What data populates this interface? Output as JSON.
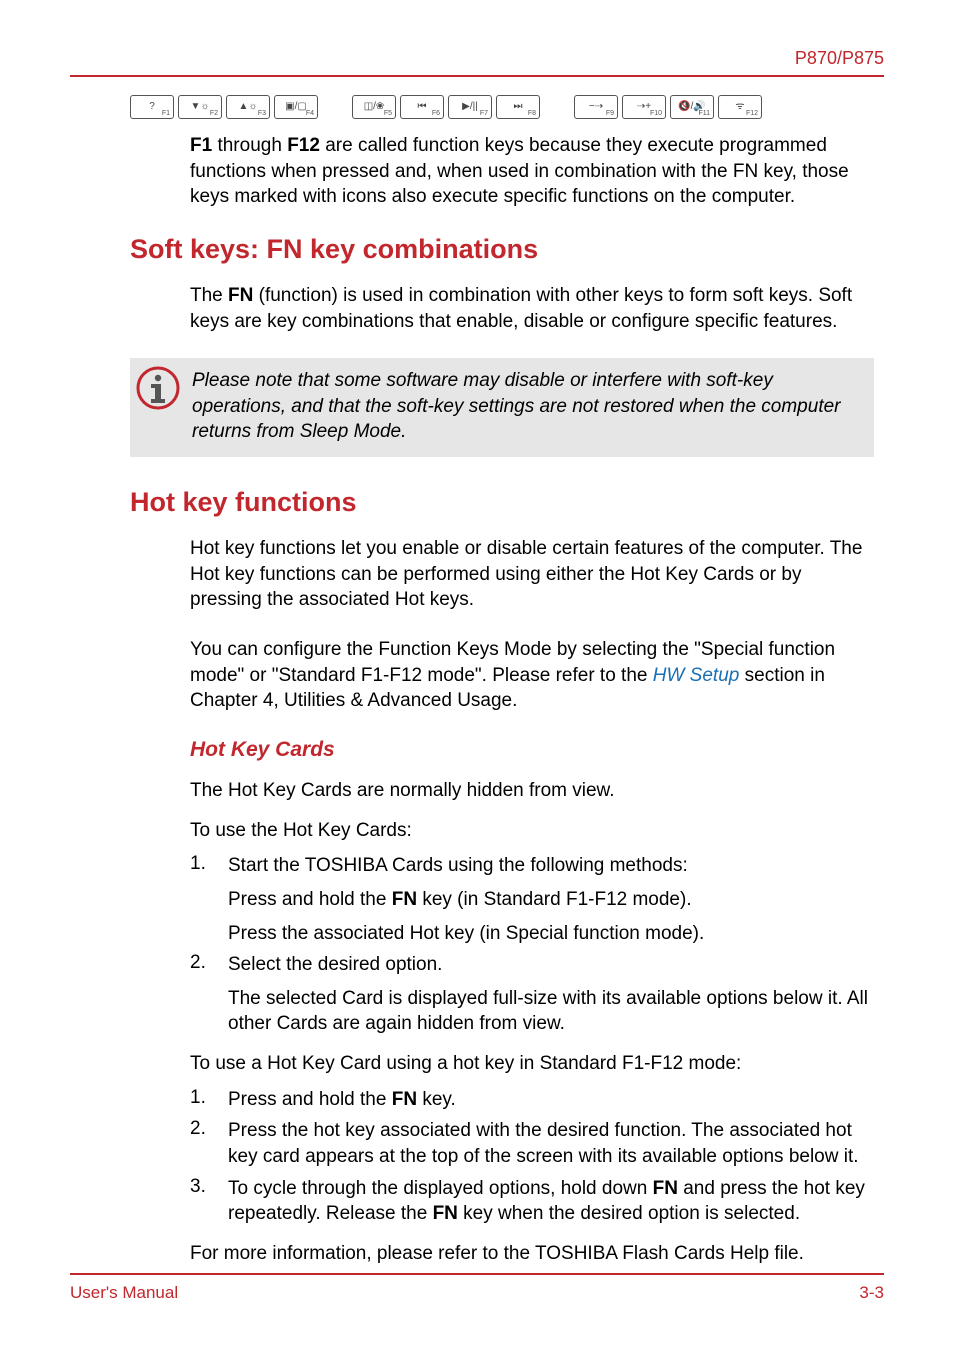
{
  "header": {
    "model": "P870/P875"
  },
  "fn_keys": [
    {
      "glyph": "?",
      "num": "F1"
    },
    {
      "glyph": "▼☼",
      "num": "F2"
    },
    {
      "glyph": "▲☼",
      "num": "F3"
    },
    {
      "glyph": "▣/▢",
      "num": "F4"
    },
    {
      "glyph": "◫/❀",
      "num": "F5"
    },
    {
      "glyph": "⏮",
      "num": "F6"
    },
    {
      "glyph": "▶/||",
      "num": "F7"
    },
    {
      "glyph": "⏭",
      "num": "F8"
    },
    {
      "glyph": "−⇢",
      "num": "F9"
    },
    {
      "glyph": "⇢+",
      "num": "F10"
    },
    {
      "glyph": "🔇/🔊",
      "num": "F11"
    },
    {
      "glyph": "ᯤ",
      "num": "F12"
    }
  ],
  "intro_para": {
    "strong1": "F1",
    "mid": " through ",
    "strong2": "F12",
    "rest": " are called function keys because they execute programmed functions when pressed and, when used in combination with the FN key, those keys marked with icons also execute specific functions on the computer."
  },
  "softkeys": {
    "heading": "Soft keys: FN key combinations",
    "para_a": "The ",
    "para_b": "FN",
    "para_c": " (function) is used in combination with other keys to form soft keys. Soft keys are key combinations that enable, disable or configure specific features."
  },
  "note": "Please note that some software may disable or interfere with soft-key operations, and that the soft-key settings are not restored when the computer returns from Sleep Mode.",
  "hotkey": {
    "heading": "Hot key functions",
    "p1": "Hot key functions let you enable or disable certain features of the computer. The Hot key functions can be performed using either the Hot Key Cards or by pressing the associated Hot keys.",
    "p2a": "You can configure the Function Keys Mode by selecting the \"Special function mode\" or \"Standard F1-F12 mode\". Please refer to the ",
    "p2_link": "HW Setup",
    "p2b": " section in Chapter 4, Utilities & Advanced Usage."
  },
  "cards": {
    "heading": "Hot Key Cards",
    "p1": "The Hot Key Cards are normally hidden from view.",
    "p2": "To use the Hot Key Cards:",
    "list1": [
      {
        "n": "1.",
        "text": "Start the TOSHIBA Cards using the following methods:",
        "subs": [
          {
            "a": "Press and hold the ",
            "b": "FN",
            "c": " key (in Standard F1-F12 mode)."
          },
          {
            "a": "Press the associated Hot key (in Special function mode).",
            "b": "",
            "c": ""
          }
        ]
      },
      {
        "n": "2.",
        "text": "Select the desired option.",
        "subs": [
          {
            "a": "The selected Card is displayed full-size with its available options below it. All other Cards are again hidden from view.",
            "b": "",
            "c": ""
          }
        ]
      }
    ],
    "p3": "To use a Hot Key Card using a hot key in Standard F1-F12 mode:",
    "list2": [
      {
        "n": "1.",
        "a": "Press and hold the ",
        "b": "FN",
        "c": " key."
      },
      {
        "n": "2.",
        "a": "Press the hot key associated with the desired function. The associated hot key card appears at the top of the screen with its available options below it.",
        "b": "",
        "c": ""
      },
      {
        "n": "3.",
        "a": "To cycle through the displayed options, hold down ",
        "b": "FN",
        "c": " and press the hot key repeatedly. Release the ",
        "d": "FN",
        "e": " key when the desired option is selected."
      }
    ],
    "p4": "For more information, please refer to the TOSHIBA Flash Cards Help file."
  },
  "footer": {
    "left": "User's Manual",
    "right": "3-3"
  }
}
